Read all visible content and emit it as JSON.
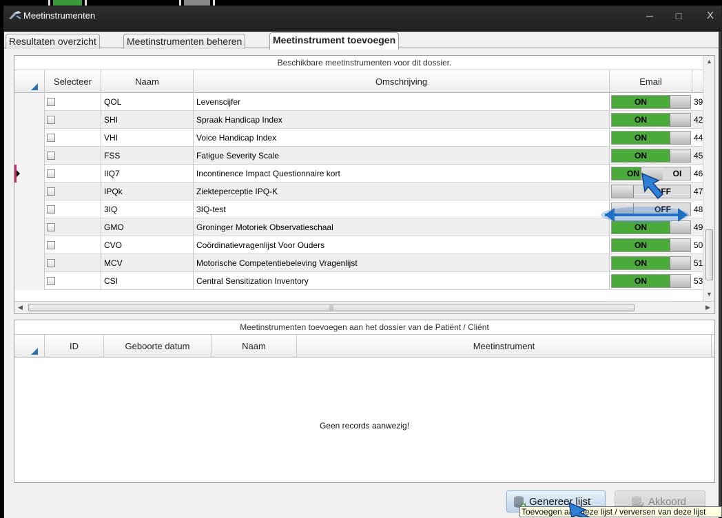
{
  "window": {
    "title": "Meetinstrumenten"
  },
  "tabs": [
    {
      "label": "Resultaten overzicht"
    },
    {
      "label": "Meetinstrumenten beheren"
    },
    {
      "label": "Meetinstrument toevoegen"
    }
  ],
  "top_panel": {
    "caption": "Beschikbare meetinstrumenten voor dit dossier.",
    "columns": {
      "select": "Selecteer",
      "name": "Naam",
      "description": "Omschrijving",
      "email": "Email"
    },
    "rows": [
      {
        "code": "QOL",
        "description": "Levenscijfer",
        "email": "ON",
        "num": "39"
      },
      {
        "code": "SHI",
        "description": "Spraak Handicap Index",
        "email": "ON",
        "num": "42"
      },
      {
        "code": "VHI",
        "description": "Voice Handicap Index",
        "email": "ON",
        "num": "44"
      },
      {
        "code": "FSS",
        "description": "Fatigue Severity Scale",
        "email": "ON",
        "num": "45"
      },
      {
        "code": "IIQ7",
        "description": "Incontinence Impact Questionnaire kort",
        "email": "ON",
        "email_off": "OI",
        "num": "46"
      },
      {
        "code": "IPQk",
        "description": "Ziekteperceptie IPQ-K",
        "email": "OFF",
        "num": "47"
      },
      {
        "code": "3IQ",
        "description": "3IQ-test",
        "email": "OFF",
        "num": "48"
      },
      {
        "code": "GMO",
        "description": "Groninger Motoriek Observatieschaal",
        "email": "ON",
        "num": "49"
      },
      {
        "code": "CVO",
        "description": "Coördinatievragenlijst Voor Ouders",
        "email": "ON",
        "num": "50"
      },
      {
        "code": "MCV",
        "description": "Motorische Competentiebeleving Vragenlijst",
        "email": "ON",
        "num": "51"
      },
      {
        "code": "CSI",
        "description": "Central Sensitization Inventory",
        "email": "ON",
        "num": "53"
      }
    ]
  },
  "bottom_panel": {
    "caption": "Meetinstrumenten toevoegen aan het dossier van de Patiënt / Cliënt",
    "columns": {
      "id": "ID",
      "birthdate": "Geboorte datum",
      "name": "Naam",
      "instrument": "Meetinstrument"
    },
    "empty_text": "Geen records aanwezig!"
  },
  "buttons": {
    "generate": "Genereer lijst",
    "accept": "Akkoord"
  },
  "tooltip": "Toevoegen aan deze lijst / verversen van deze lijst",
  "colors": {
    "toggle_on": "#4aaa3a",
    "accent_blue": "#2f6fb0",
    "row_marker": "#c0306a"
  }
}
